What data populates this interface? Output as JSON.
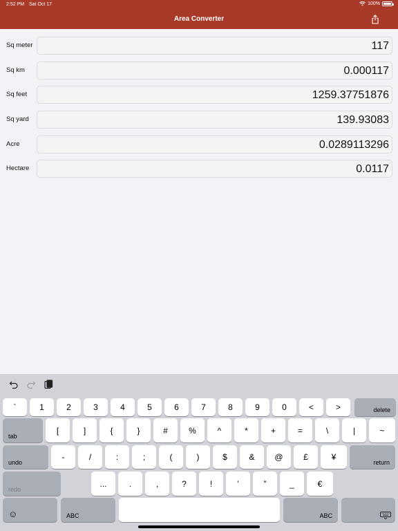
{
  "status": {
    "time": "2:52 PM",
    "date": "Sat Oct 17",
    "battery": "100%"
  },
  "header": {
    "title": "Area Converter",
    "share_icon": "share-icon"
  },
  "rows": [
    {
      "label": "Sq meter",
      "value": "117"
    },
    {
      "label": "Sq km",
      "value": "0.000117"
    },
    {
      "label": "Sq feet",
      "value": "1259.37751876"
    },
    {
      "label": "Sq yard",
      "value": "139.93083"
    },
    {
      "label": "Acre",
      "value": "0.0289113296"
    },
    {
      "label": "Hectare",
      "value": "0.0117"
    }
  ],
  "keyboard": {
    "toolbar": [
      "undo-icon",
      "redo-icon",
      "paste-icon"
    ],
    "row1": [
      "`",
      "1",
      "2",
      "3",
      "4",
      "5",
      "6",
      "7",
      "8",
      "9",
      "0",
      "<",
      ">"
    ],
    "delete": "delete",
    "tab": "tab",
    "row2": [
      "[",
      "]",
      "{",
      "}",
      "#",
      "%",
      "^",
      "*",
      "+",
      "=",
      "\\",
      "|",
      "~"
    ],
    "undo": "undo",
    "row3": [
      "-",
      "/",
      ":",
      ";",
      "(",
      ")",
      "$",
      "&",
      "@",
      "£",
      "¥"
    ],
    "return": "return",
    "redo": "redo",
    "row4": [
      "...",
      ".",
      ",",
      "?",
      "!",
      "’",
      "”",
      "_",
      "€"
    ],
    "emoji": "☺",
    "abc_left": "ABC",
    "abc_right": "ABC",
    "hide_icon": "keyboard-dismiss-icon"
  }
}
